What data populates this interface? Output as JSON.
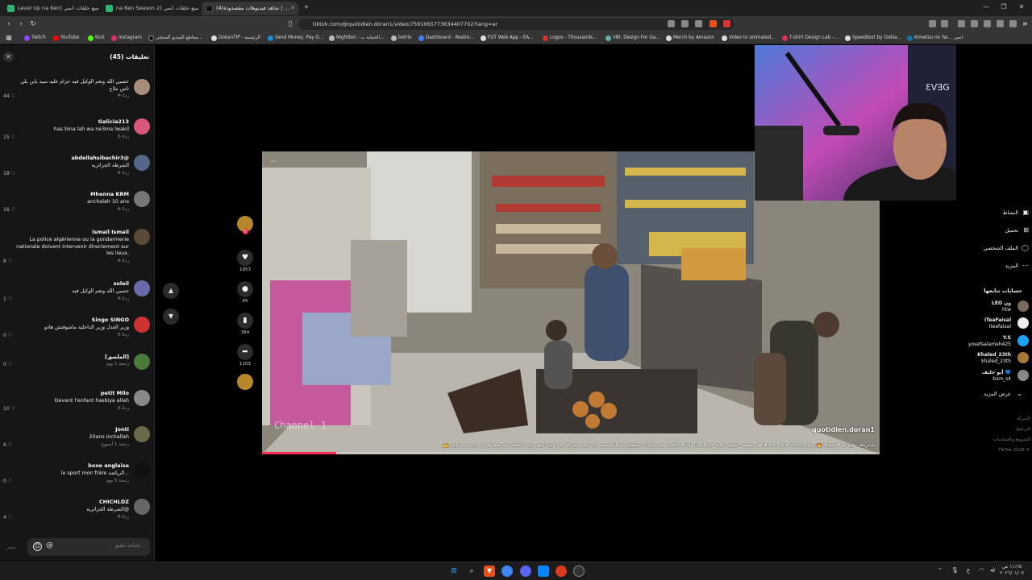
{
  "browser": {
    "tabs": [
      {
        "label": "Level Up na Ken) جميع حلقات انمي",
        "active": false
      },
      {
        "label": "na Ken Season 2) جميع حلقات انمي",
        "active": false
      },
      {
        "label": "(4)شاهد فيديوهات مقصدودة | ...",
        "active": true
      }
    ],
    "new_tab_label": "+",
    "url": "tiktok.com/@quotidien.doran1/video/7591065773634407702?lang=ar",
    "bookmarks": [
      "Twitch",
      "YouTube",
      "Kick",
      "Instagram",
      "مقاطع الفيديو المنتجي...",
      "DokanTIP - الرئيسية",
      "Send Money, Pay O...",
      "Nightbot - الحماية ب...",
      "botrix",
      "Dashboard - Restre...",
      "FUT Web App - EA...",
      "Logos - Thousands...",
      "VBI: Design For Ga...",
      "Merch by Amazon",
      "Video to animated...",
      "T-shirt Design Lab -...",
      "Speedtest by Ookla...",
      "Kimetsu no Yai... انمي"
    ]
  },
  "comments": {
    "title": "تعليقات (45)",
    "close_icon": "close-icon",
    "reply_label": "رد",
    "items": [
      {
        "user": "",
        "text": "حسبي الله ونعم الوكيل فيه حرام عليه سيد بابن بلي ناس ملاح",
        "meta": "1-4",
        "likes": "44",
        "avatar_color": "#a88d7a"
      },
      {
        "user": "Galicia213",
        "text": "has bina lah wa ne3ma lwakil",
        "meta": "1-3",
        "likes": "15",
        "avatar_color": "#d9577a"
      },
      {
        "user": "abdellahsibachir3@",
        "text": "الشرطة الجزائرية",
        "meta": "1-4",
        "likes": "18",
        "avatar_color": "#556688"
      },
      {
        "user": "Mhenna KRM",
        "text": "anchalah 10 ans",
        "meta": "1-4",
        "likes": "16",
        "avatar_color": "#777777"
      },
      {
        "user": "ismail Ismail",
        "text": "La police algérienne ou la gondarmerie nationale doivent intervenir directement sur les lieux.",
        "meta": "1-4",
        "likes": "8",
        "avatar_color": "#5a4a3a"
      },
      {
        "user": "soleil",
        "text": "حسبي الله ونعم الوكيل فيه",
        "meta": "1-4",
        "likes": "1",
        "avatar_color": "#6a6aa8"
      },
      {
        "user": "Singo SINGO",
        "text": "وزير العدل وزير الداخلية ماشوفتش هاذو",
        "meta": "1-5",
        "likes": "0",
        "avatar_color": "#cc3333"
      },
      {
        "user": "[الملصق]",
        "text": "",
        "meta": "منذ 1 يوم",
        "likes": "0",
        "avatar_color": "#4a7a3a"
      },
      {
        "user": "petit Milo",
        "text": "Devant l'enfant hasbiya allah",
        "meta": "1-3",
        "likes": "10",
        "avatar_color": "#888888"
      },
      {
        "user": "Jonti",
        "text": "20ans inchallah",
        "meta": "منذ 1 أسبوع",
        "likes": "6",
        "avatar_color": "#6a6a4a"
      },
      {
        "user": "boxe anglaise",
        "text": "le sport mon frère الرياضة...",
        "meta": "منذ 5 يوم",
        "likes": "0",
        "avatar_color": "#111111"
      },
      {
        "user": "CHICHLDZ",
        "text": "الشرطة الجزائرية@",
        "meta": "1-4",
        "likes": "4",
        "avatar_color": "#666666"
      }
    ],
    "input_placeholder": "إضافة تعليق...",
    "post_label": "نشر"
  },
  "video": {
    "author": "quotidien.doran1",
    "caption": "⚠️ اقتحام محل تجاري باستعمال أسلحة بيضاء من أجل السرقة، في وضح النهار بحي الحاسي-شرطة وهران. أتكل على الله #CapCut #الشعب_الصيني_ماله_حل 😂 #algerie #58wilayaat 🔥 #شــرطة_وهــران #بلدية",
    "watermark": "Channel 1",
    "progress": 0.12
  },
  "actions": {
    "likes": "1953",
    "comments": "45",
    "saves": "364",
    "shares": "1103"
  },
  "right_nav": {
    "items": [
      {
        "label": "النشاط",
        "icon": "inbox-icon"
      },
      {
        "label": "تحميل",
        "icon": "upload-icon"
      },
      {
        "label": "الملف الشخصي",
        "icon": "profile-icon"
      },
      {
        "label": "المزيد",
        "icon": "more-icon"
      }
    ],
    "following_title": "حسابات تتابعها",
    "following": [
      {
        "name": "LEO ون",
        "handle": "htw",
        "color": "#7a6a5a"
      },
      {
        "name": "iTeaFaisal",
        "handle": "iteafaisal",
        "color": "#eeeeee"
      },
      {
        "name": "Y.S",
        "handle": "yosefsalameh425",
        "color": "#1da1f2"
      },
      {
        "name": "Khaled_23th",
        "handle": "khaled_23th",
        "color": "#aa7733"
      },
      {
        "name": "أبو خليف 💙",
        "handle": "bsm_s4",
        "color": "#888888"
      }
    ],
    "see_more": "عرض المزيد",
    "footer": [
      "الشركة",
      "البرنامج",
      "الشروط والسياسات",
      "TikTok 2026 ©"
    ]
  },
  "taskbar": {
    "time": "١١:٢٥ ص",
    "date": "٢٠٢٦/٠١/٠٧",
    "lang": "ع"
  }
}
